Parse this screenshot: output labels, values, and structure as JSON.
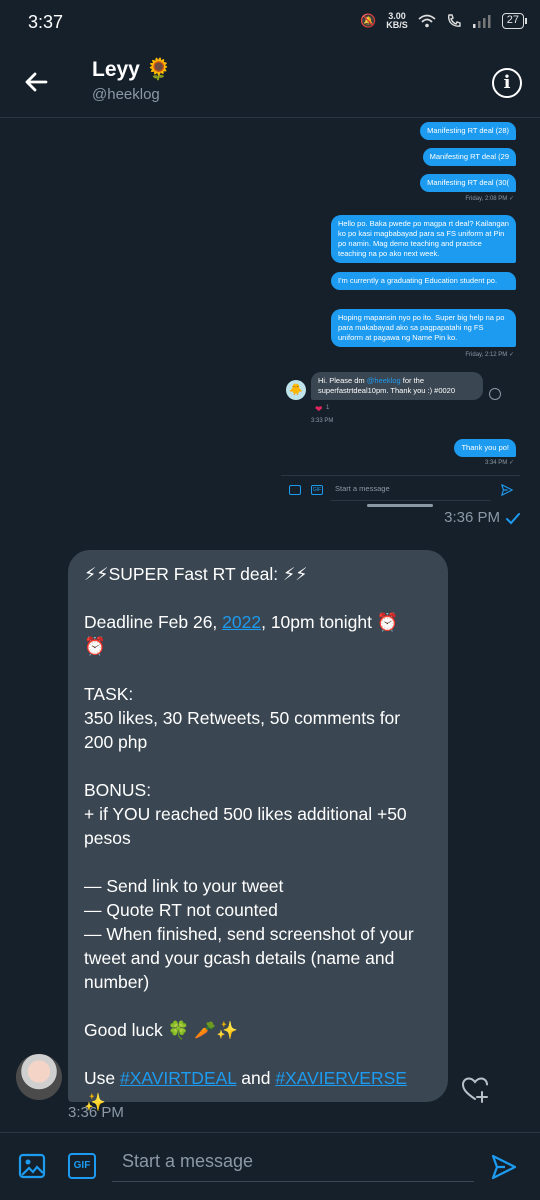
{
  "status_bar": {
    "time": "3:37",
    "speed_value": "3.00",
    "speed_unit": "KB/S",
    "battery": "27"
  },
  "header": {
    "name": "Leyy 🌻",
    "handle": "@heeklog"
  },
  "embedded_screenshot": {
    "sent_top": [
      "Manifesting RT deal (28)",
      "Manifesting RT deal (29",
      "Manifesting RT deal (30("
    ],
    "ts_1": "Friday, 2:08 PM ✓",
    "sent_mid": [
      "Hello po. Baka pwede po magpa rt deal? Kailangan ko po kasi magbabayad para sa FS uniform at Pin po namin. Mag demo teaching and practice teaching na po ako next week.",
      "I'm currently a graduating Education student po.",
      "Hoping mapansin nyo po ito. Super big help na po para makabayad ako sa pagpapatahi ng FS uniform at pagawa ng Name Pin ko."
    ],
    "ts_2": "Friday, 2:12 PM ✓",
    "received": {
      "before": "Hi. Please dm ",
      "link": "@heeklog",
      "after": " for the superfastrtdeal10pm. Thank you :) #0020"
    },
    "heart_count": "1",
    "ts_3": "3:33 PM",
    "sent_last": "Thank you po!",
    "ts_4": "3:34 PM ✓",
    "compose_placeholder": "Start a message",
    "gif_label": "GIF"
  },
  "main_timestamp": "3:36 PM",
  "message": {
    "line_1": "⚡⚡SUPER Fast RT deal: ⚡⚡",
    "deadline_prefix": "Deadline Feb 26, ",
    "deadline_year": "2022",
    "deadline_suffix": ", 10pm tonight ⏰",
    "deadline_line2": "⏰",
    "task_heading": "TASK:",
    "task_line_1": "350 likes, 30 Retweets, 50 comments for",
    "task_line_2": "200 php",
    "bonus_heading": "BONUS:",
    "bonus_line_1": "+ if YOU reached 500 likes additional +50",
    "bonus_line_2": "pesos",
    "rule_1": "— Send link to your tweet",
    "rule_2": "— Quote RT not counted",
    "rule_3a": "— When finished, send screenshot of your",
    "rule_3b": "tweet and your gcash details (name and",
    "rule_3c": "number)",
    "good_luck": "Good luck 🍀 🥕✨",
    "use_prefix": "Use ",
    "hashtag_1": "#XAVIRTDEAL",
    "use_and": " and ",
    "hashtag_2": "#XAVIERVERSE",
    "use_suffix": " ✨"
  },
  "message_timestamp": "3:36 PM",
  "compose": {
    "placeholder": "Start a message",
    "gif_label": "GIF"
  },
  "colors": {
    "background": "#15202b",
    "accent": "#1d9bf0",
    "received_bubble": "#3a4651",
    "muted_text": "#8b98a5"
  },
  "icons": [
    "back-arrow-icon",
    "info-icon",
    "image-icon",
    "gif-icon",
    "send-icon",
    "add-reaction-icon",
    "checkmark-icon"
  ]
}
